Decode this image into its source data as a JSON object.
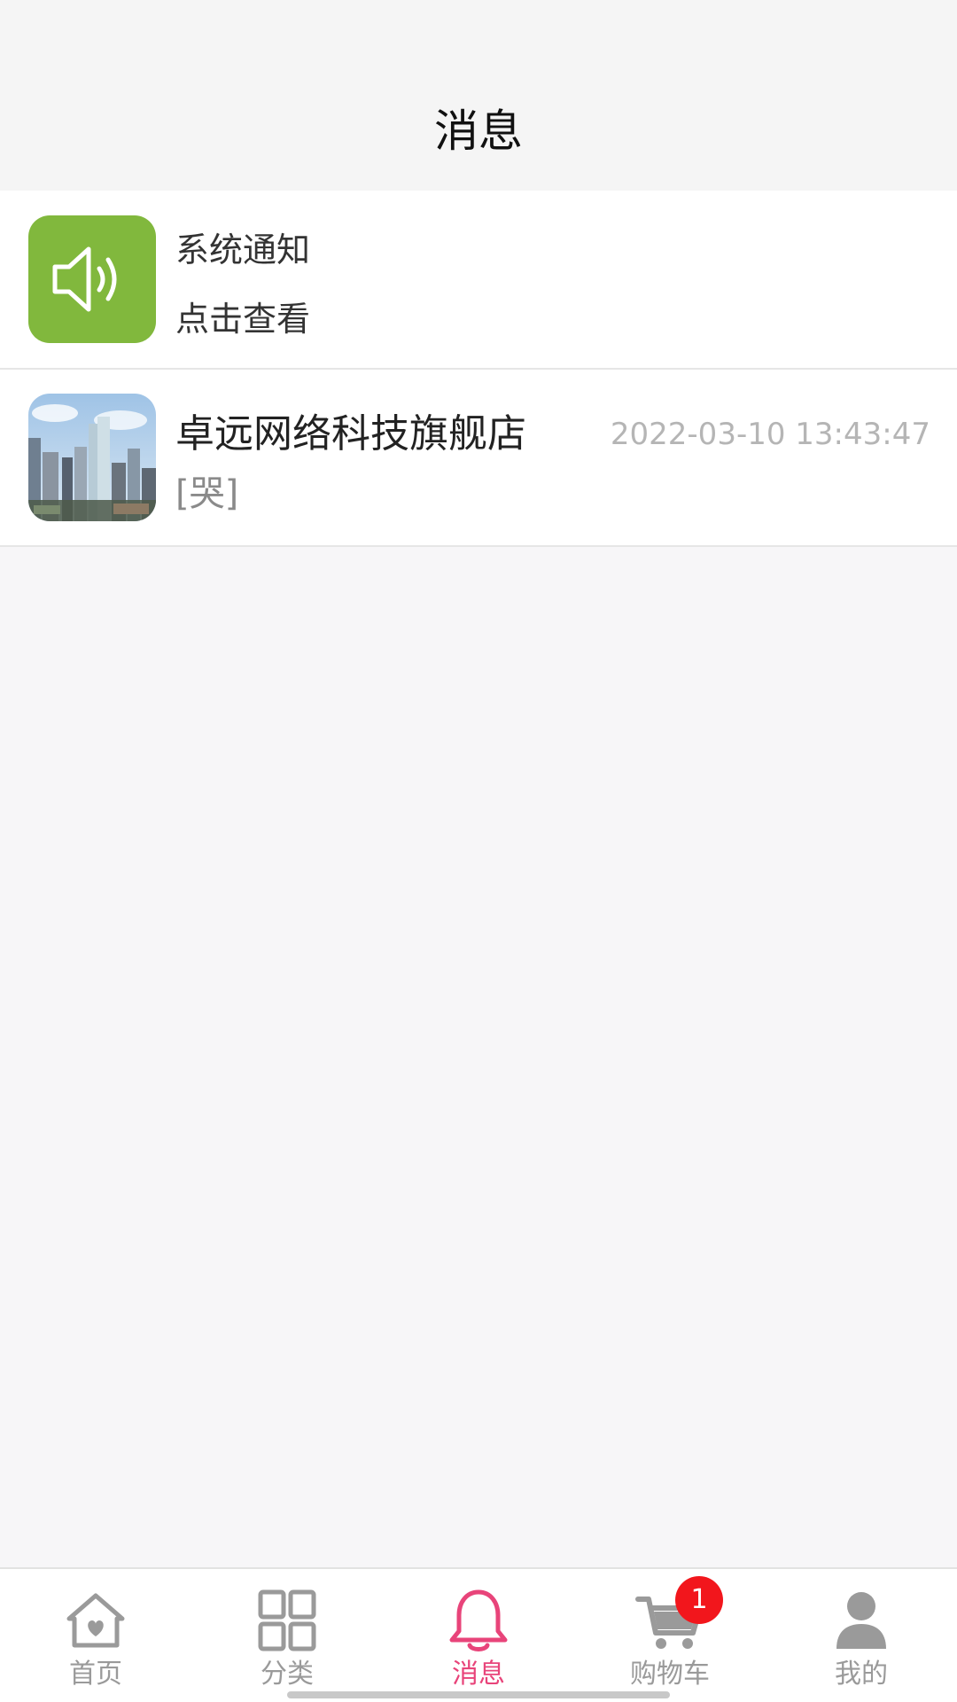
{
  "header": {
    "title": "消息"
  },
  "conversations": [
    {
      "title": "系统通知",
      "subtitle": "点击查看",
      "icon": "speaker-icon",
      "icon_bg": "#81b83d"
    },
    {
      "title": "卓远网络科技旗舰店",
      "time": "2022-03-10 13:43:47",
      "message": "[哭]",
      "avatar": "city-skyline-photo"
    }
  ],
  "tabbar": {
    "active_color": "#e8447a",
    "inactive_color": "#9a9a9a",
    "items": [
      {
        "label": "首页",
        "icon": "home-icon"
      },
      {
        "label": "分类",
        "icon": "grid-icon"
      },
      {
        "label": "消息",
        "icon": "bell-icon",
        "active": true
      },
      {
        "label": "购物车",
        "icon": "cart-icon",
        "badge": "1"
      },
      {
        "label": "我的",
        "icon": "person-icon"
      }
    ]
  }
}
